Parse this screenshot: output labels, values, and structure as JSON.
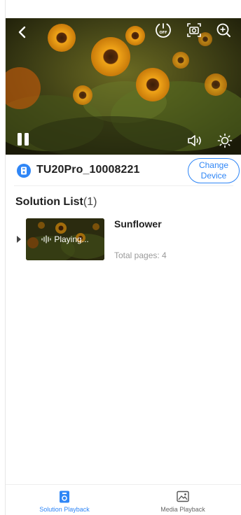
{
  "colors": {
    "accent": "#2f86f6",
    "text": "#1f1f1f",
    "muted": "#9a9a9a"
  },
  "video": {
    "icons": {
      "back": "back-arrow-icon",
      "power": "power-off-icon",
      "snapshot": "camera-snapshot-icon",
      "zoom": "zoom-in-icon",
      "pause": "pause-icon",
      "volume": "volume-icon",
      "brightness": "brightness-icon"
    }
  },
  "device": {
    "name": "TU20Pro_10008221",
    "change_button": "Change Device"
  },
  "solution_list": {
    "title": "Solution List",
    "count": "(1)",
    "items": [
      {
        "name": "Sunflower",
        "status": "Playing...",
        "pages": "Total pages: 4"
      }
    ]
  },
  "bottom_nav": {
    "items": [
      {
        "label": "Solution Playback",
        "active": true
      },
      {
        "label": "Media Playback",
        "active": false
      }
    ]
  }
}
